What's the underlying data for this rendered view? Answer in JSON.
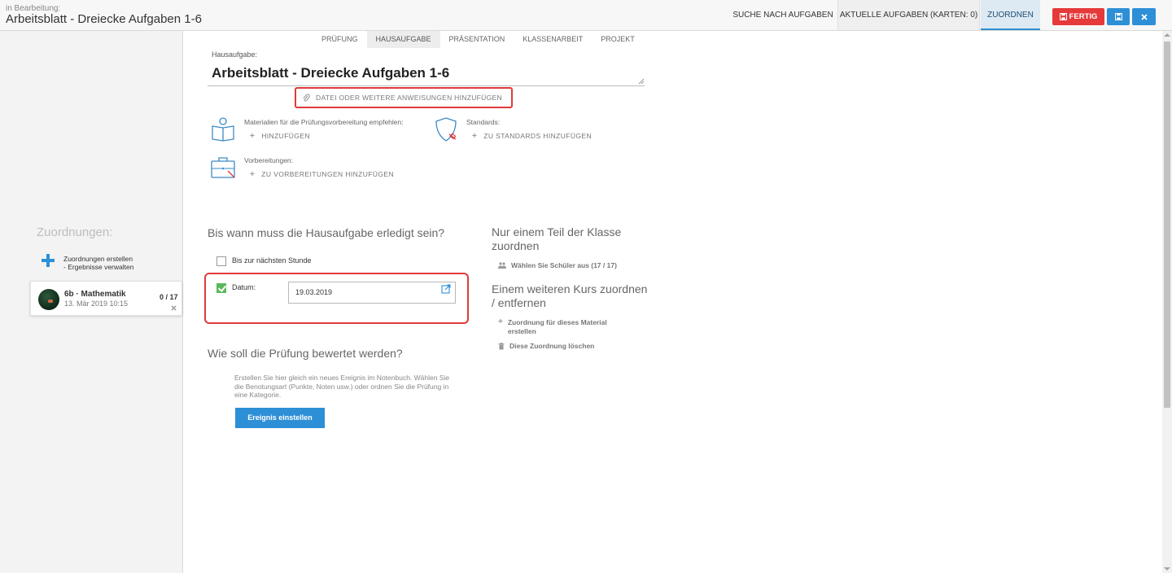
{
  "header": {
    "status": "in Bearbeitung:",
    "title": "Arbeitsblatt - Dreiecke Aufgaben 1-6",
    "nav": {
      "search": "SUCHE NACH AUFGABEN",
      "current": "AKTUELLE AUFGABEN (KARTEN: 0)",
      "assign": "ZUORDNEN"
    },
    "buttons": {
      "done": "FERTIG"
    }
  },
  "sidebar": {
    "heading": "Zuordnungen:",
    "create_line1": "Zuordnungen erstellen",
    "create_line2": "- Ergebnisse verwalten",
    "assignment": {
      "course": "6b · Mathematik",
      "date": "13. Mär 2019 10:15",
      "count": "0 / 17"
    }
  },
  "type_tabs": [
    "PRÜFUNG",
    "HAUSAUFGABE",
    "PRÄSENTATION",
    "KLASSENARBEIT",
    "PROJEKT"
  ],
  "active_type_tab": 1,
  "form": {
    "title_label": "Hausaufgabe:",
    "title_value": "Arbeitsblatt - Dreiecke Aufgaben 1-6",
    "attach_label": "DATEI ODER WEITERE ANWEISUNGEN HINZUFÜGEN",
    "materials_label": "Materialien für die Prüfungsvorbereitung empfehlen:",
    "materials_link": "HINZUFÜGEN",
    "standards_label": "Standards:",
    "standards_link": "ZU STANDARDS HINZUFÜGEN",
    "preparations_label": "Vorbereitungen:",
    "preparations_link": "ZU VORBEREITUNGEN HINZUFÜGEN"
  },
  "due": {
    "heading": "Bis wann muss die Hausaufgabe erledigt sein?",
    "next_lesson_label": "Bis zur nächsten Stunde",
    "next_lesson_checked": false,
    "date_label": "Datum:",
    "date_checked": true,
    "date_value": "19.03.2019"
  },
  "grading": {
    "heading": "Wie soll die Prüfung bewertet werden?",
    "description": "Erstellen Sie hier gleich ein neues Ereignis im Notenbuch. Wählen Sie die Benotungsart (Punkte, Noten usw.) oder ordnen Sie die Prüfung in eine Kategorie.",
    "button": "Ereignis einstellen"
  },
  "right_panel": {
    "partial_heading_1": "Nur einem Teil der Klasse",
    "partial_heading_2": "zuordnen",
    "select_students": "Wählen Sie Schüler aus (17 / 17)",
    "other_course_heading_1": "Einem weiteren Kurs zuordnen",
    "other_course_heading_2": "/ entfernen",
    "add_assignment_1": "Zuordnung für dieses Material",
    "add_assignment_2": "erstellen",
    "delete_assignment": "Diese Zuordnung löschen"
  },
  "colors": {
    "accent": "#2d8fd6",
    "danger": "#e5393a",
    "success": "#5cb85c"
  }
}
